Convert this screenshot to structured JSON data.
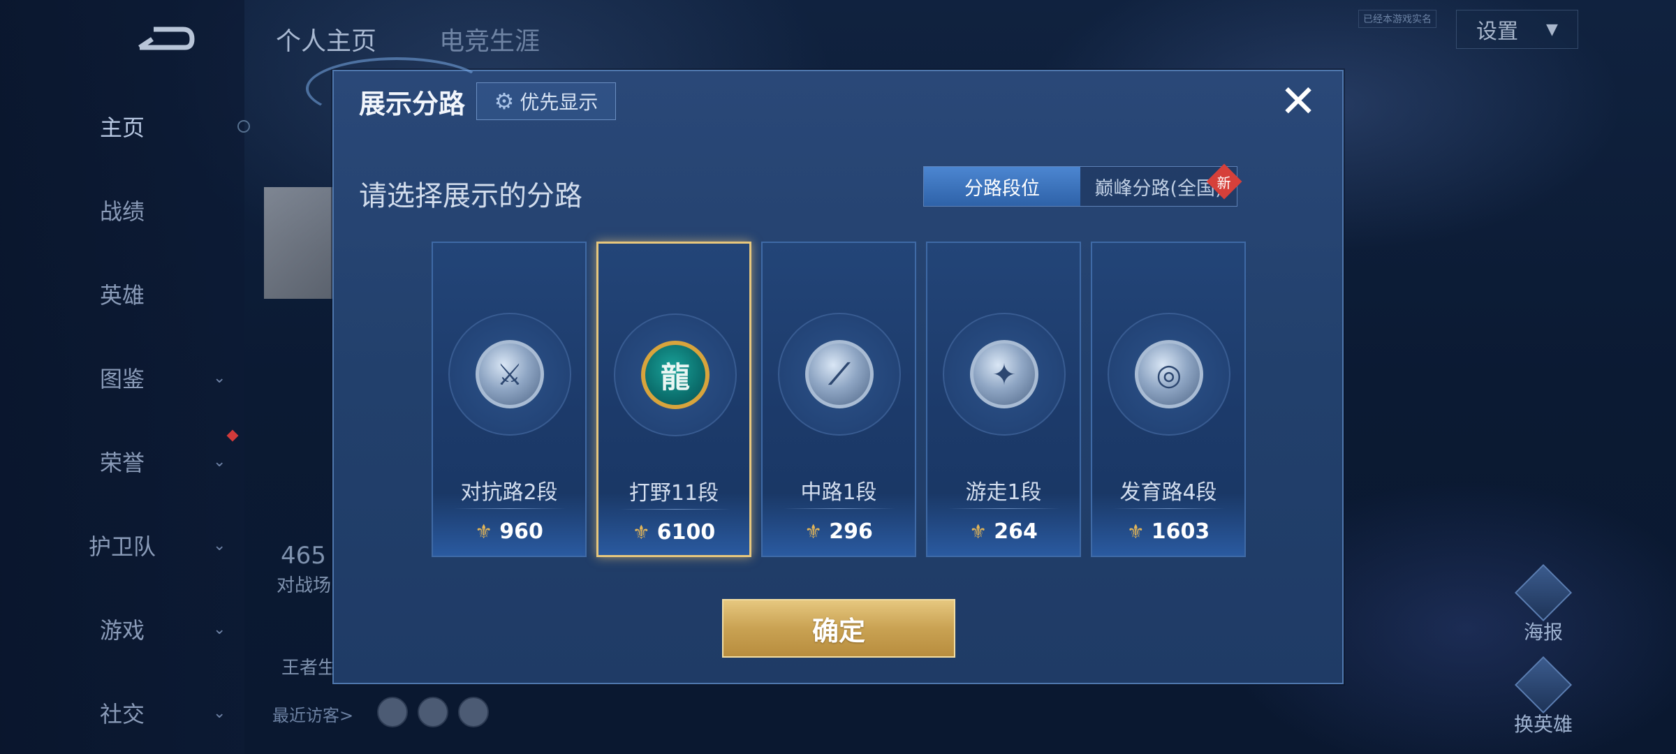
{
  "top_tabs": [
    "个人主页",
    "电竞生涯"
  ],
  "settings": {
    "label": "设置",
    "tag": "已经本游戏实名"
  },
  "sidebar": {
    "items": [
      {
        "label": "主页",
        "active": true,
        "has_chevron": false
      },
      {
        "label": "战绩",
        "has_chevron": false
      },
      {
        "label": "英雄",
        "has_chevron": false
      },
      {
        "label": "图鉴",
        "has_chevron": true
      },
      {
        "label": "荣誉",
        "has_chevron": true,
        "notification": true
      },
      {
        "label": "护卫队",
        "has_chevron": true
      },
      {
        "label": "游戏",
        "has_chevron": true
      },
      {
        "label": "社交",
        "has_chevron": true
      }
    ]
  },
  "background": {
    "stat_value": "465",
    "stat_label": "对战场",
    "king_label": "王者生",
    "recent_visitors": "最近访客>",
    "right_buttons": [
      "海报",
      "换英雄"
    ]
  },
  "modal": {
    "title": "展示分路",
    "priority_button": "优先显示",
    "subtitle": "请选择展示的分路",
    "segments": [
      {
        "label": "分路段位",
        "selected": true
      },
      {
        "label": "巅峰分路(全国)",
        "selected": false
      }
    ],
    "new_badge": "新",
    "lanes": [
      {
        "name": "对抗路2段",
        "score": "960",
        "selected": false,
        "icon": "sword-emblem-icon",
        "glyph": "⚔"
      },
      {
        "name": "打野11段",
        "score": "6100",
        "selected": true,
        "icon": "dragon-emblem-icon",
        "glyph": "龍"
      },
      {
        "name": "中路1段",
        "score": "296",
        "selected": false,
        "icon": "staff-emblem-icon",
        "glyph": "⟋"
      },
      {
        "name": "游走1段",
        "score": "264",
        "selected": false,
        "icon": "wings-emblem-icon",
        "glyph": "✦"
      },
      {
        "name": "发育路4段",
        "score": "1603",
        "selected": false,
        "icon": "target-emblem-icon",
        "glyph": "◎"
      }
    ],
    "confirm_label": "确定"
  },
  "colors": {
    "accent_gold": "#e7c77d",
    "panel_blue": "#22406c",
    "selected_segment": "#3a72bd"
  }
}
